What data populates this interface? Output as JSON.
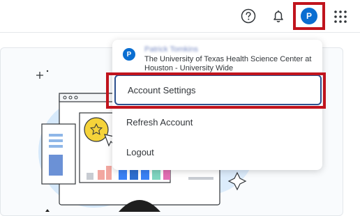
{
  "header": {
    "help_icon": "question-circle-icon",
    "notifications_icon": "bell-icon",
    "avatar_initial": "P",
    "apps_icon": "grid-icon"
  },
  "user_menu": {
    "avatar_initial": "P",
    "user_name": "Patrick Tomkins",
    "organization": "The University of Texas Health Science Center at Houston - University Wide",
    "items": [
      {
        "label": "Account Settings"
      },
      {
        "label": "Refresh Account"
      },
      {
        "label": "Logout"
      }
    ]
  },
  "colors": {
    "accent": "#0a6ed1",
    "highlight": "#c0141d",
    "focus_border": "#2b4f8e"
  }
}
